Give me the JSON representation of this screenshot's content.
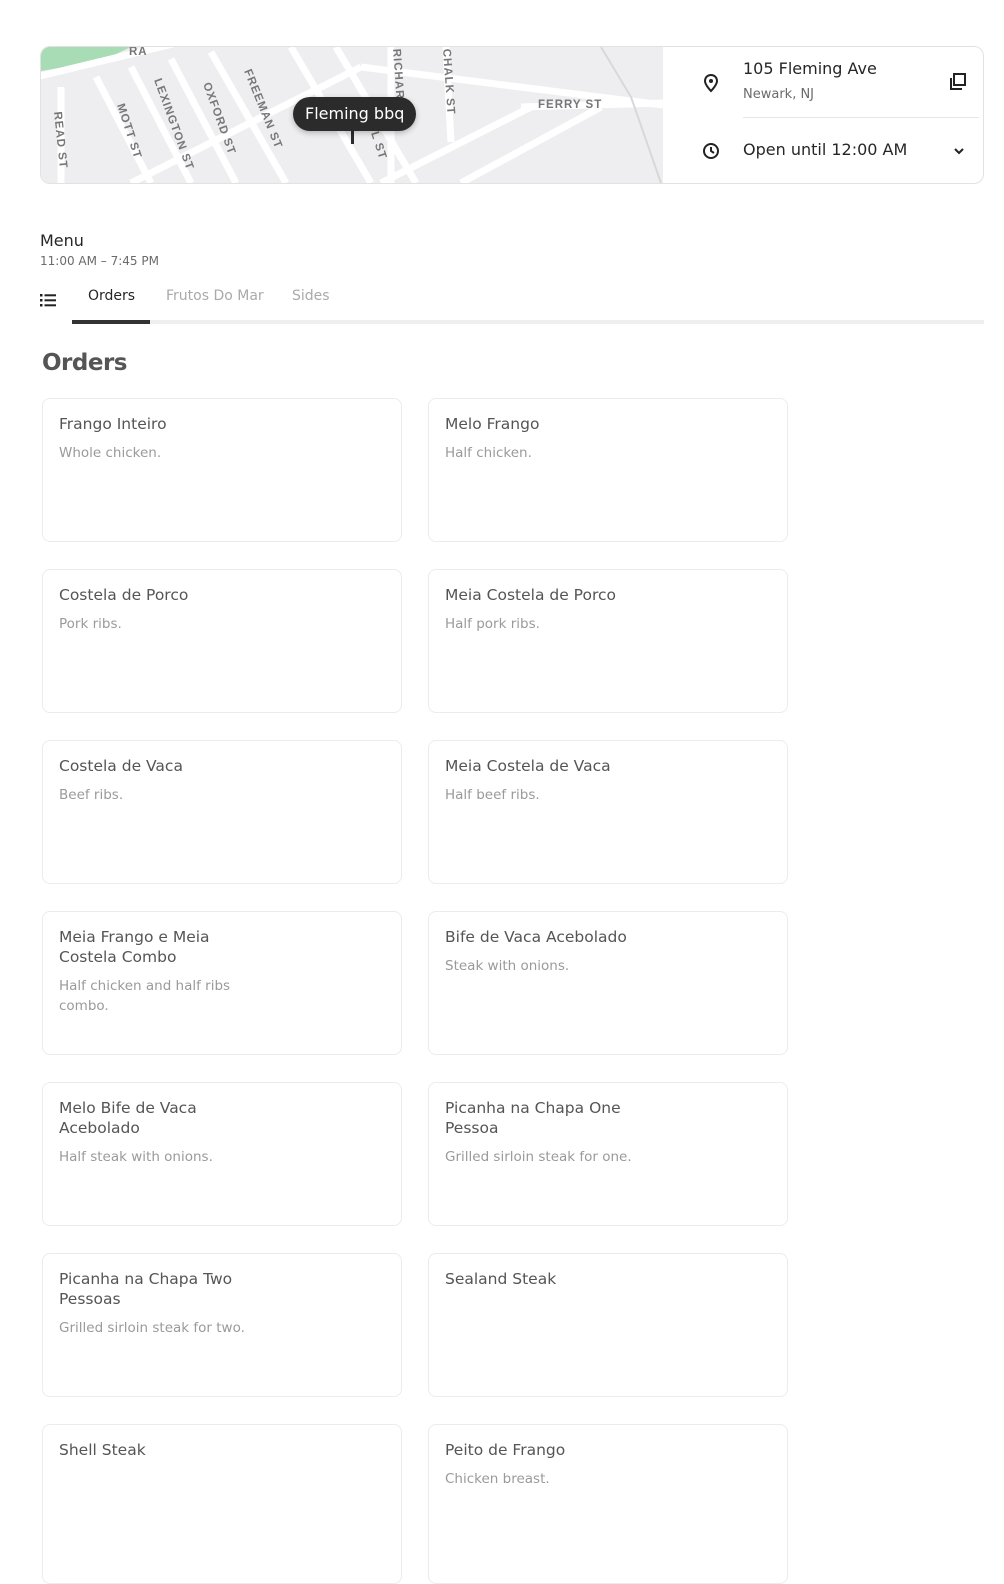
{
  "store": {
    "map_pin_label": "Fleming bbq",
    "map_streets": [
      "RA",
      "READ ST",
      "MOTT ST",
      "LEXINGTON ST",
      "OXFORD ST",
      "FREEMAN ST",
      "RICHARD",
      "CHALK ST",
      "FERRY ST",
      "L ST"
    ],
    "address_line1": "105 Fleming Ave",
    "address_line2": "Newark, NJ",
    "hours_status": "Open until 12:00 AM"
  },
  "menu": {
    "title": "Menu",
    "hours": "11:00 AM – 7:45 PM",
    "tabs": [
      {
        "label": "Orders",
        "active": true
      },
      {
        "label": "Frutos Do Mar",
        "active": false
      },
      {
        "label": "Sides",
        "active": false
      }
    ]
  },
  "section": {
    "title": "Orders",
    "items": [
      {
        "name": "Frango Inteiro",
        "desc": "Whole chicken."
      },
      {
        "name": "Melo Frango",
        "desc": "Half chicken."
      },
      {
        "name": "Costela de Porco",
        "desc": "Pork ribs."
      },
      {
        "name": "Meia Costela de Porco",
        "desc": "Half pork ribs."
      },
      {
        "name": "Costela de Vaca",
        "desc": "Beef ribs."
      },
      {
        "name": "Meia Costela de Vaca",
        "desc": "Half beef ribs."
      },
      {
        "name": "Meia Frango e Meia Costela Combo",
        "desc": "Half chicken and half ribs combo."
      },
      {
        "name": "Bife de Vaca Acebolado",
        "desc": "Steak with onions."
      },
      {
        "name": "Melo Bife de Vaca Acebolado",
        "desc": "Half steak with onions."
      },
      {
        "name": "Picanha na Chapa One Pessoa",
        "desc": "Grilled sirloin steak for one."
      },
      {
        "name": "Picanha na Chapa Two Pessoas",
        "desc": "Grilled sirloin steak for two."
      },
      {
        "name": "Sealand Steak",
        "desc": ""
      },
      {
        "name": "Shell Steak",
        "desc": ""
      },
      {
        "name": "Peito de Frango",
        "desc": "Chicken breast."
      }
    ]
  }
}
